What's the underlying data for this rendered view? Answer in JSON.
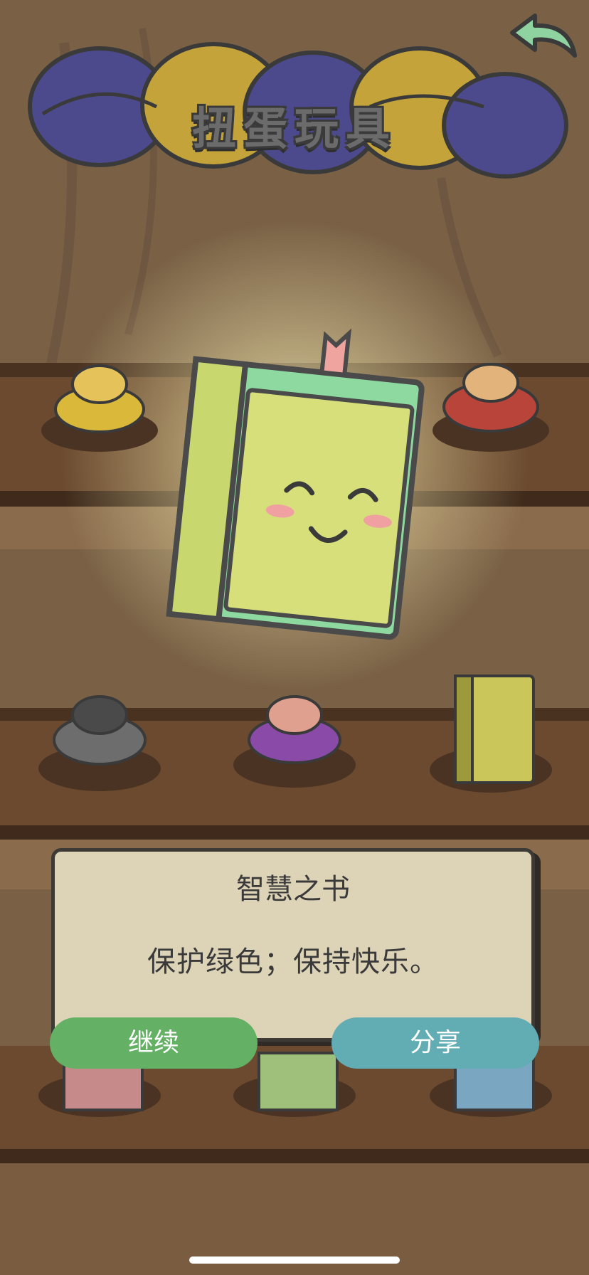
{
  "header": {
    "title": "扭蛋玩具"
  },
  "reward": {
    "item_name": "智慧之书",
    "description": "保护绿色；保持快乐。"
  },
  "buttons": {
    "continue_label": "继续",
    "share_label": "分享"
  },
  "icons": {
    "back": "back-arrow-icon"
  },
  "colors": {
    "continue_button": "#64b065",
    "share_button": "#62adb4",
    "background_wood": "#7a6146",
    "book_cover": "#d6df7a",
    "book_edge": "#8ed9a0"
  }
}
